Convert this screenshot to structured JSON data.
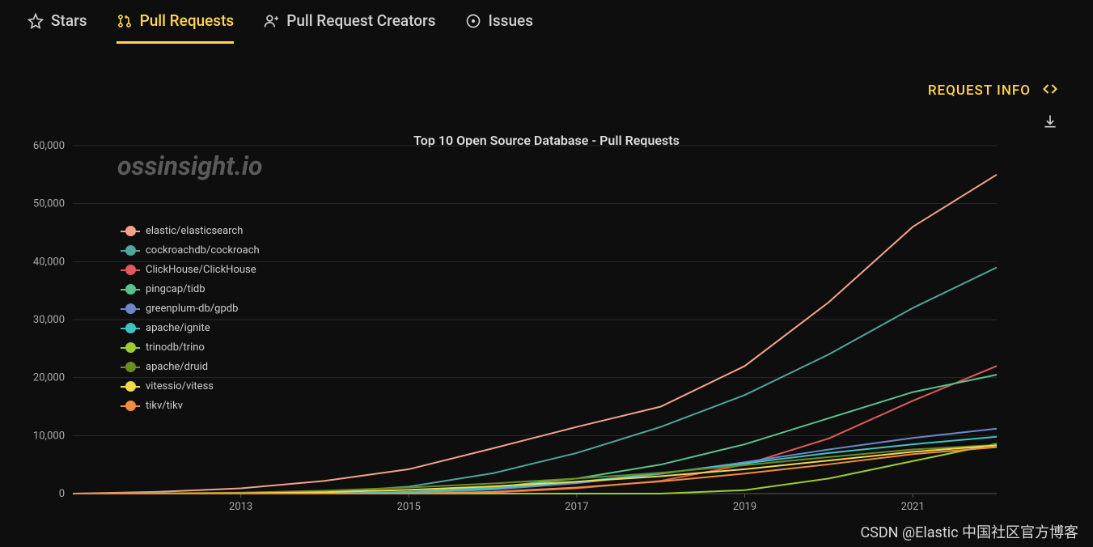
{
  "tabs": [
    {
      "label": "Stars",
      "active": false
    },
    {
      "label": "Pull Requests",
      "active": true
    },
    {
      "label": "Pull Request Creators",
      "active": false
    },
    {
      "label": "Issues",
      "active": false
    }
  ],
  "controls": {
    "request_info": "REQUEST INFO"
  },
  "watermark": "ossinsight.io",
  "csdn": "CSDN @Elastic 中国社区官方博客",
  "chart_data": {
    "type": "line",
    "title": "Top 10 Open Source Database - Pull Requests",
    "xlabel": "",
    "ylabel": "",
    "x": [
      2011,
      2012,
      2013,
      2014,
      2015,
      2016,
      2017,
      2018,
      2019,
      2020,
      2021,
      2022
    ],
    "x_ticks": [
      2013,
      2015,
      2017,
      2019,
      2021
    ],
    "ylim": [
      0,
      60000
    ],
    "y_ticks": [
      0,
      10000,
      20000,
      30000,
      40000,
      50000,
      60000
    ],
    "legend_position": "inside-top-left",
    "series": [
      {
        "name": "elastic/elasticsearch",
        "color": "#f4a28c",
        "values": [
          0,
          300,
          900,
          2200,
          4200,
          7800,
          11500,
          15000,
          22000,
          33000,
          46000,
          55000
        ]
      },
      {
        "name": "cockroachdb/cockroach",
        "color": "#4fa69a",
        "values": [
          0,
          0,
          0,
          200,
          1200,
          3500,
          7000,
          11500,
          17000,
          24000,
          32000,
          39000
        ]
      },
      {
        "name": "ClickHouse/ClickHouse",
        "color": "#e05a5a",
        "values": [
          0,
          0,
          0,
          0,
          0,
          200,
          900,
          2200,
          5000,
          9500,
          16000,
          22000
        ]
      },
      {
        "name": "pingcap/tidb",
        "color": "#5ac18e",
        "values": [
          0,
          0,
          0,
          0,
          300,
          1100,
          2600,
          5000,
          8500,
          13000,
          17500,
          20500
        ]
      },
      {
        "name": "greenplum-db/gpdb",
        "color": "#6d86c5",
        "values": [
          0,
          0,
          0,
          0,
          150,
          700,
          1800,
          3400,
          5400,
          7600,
          9600,
          11200
        ]
      },
      {
        "name": "apache/ignite",
        "color": "#3fc4c4",
        "values": [
          0,
          0,
          0,
          0,
          200,
          900,
          2000,
          3500,
          5200,
          7000,
          8500,
          9800
        ]
      },
      {
        "name": "trinodb/trino",
        "color": "#9acd32",
        "values": [
          0,
          0,
          0,
          0,
          0,
          0,
          0,
          0,
          600,
          2600,
          5600,
          8600
        ]
      },
      {
        "name": "apache/druid",
        "color": "#6b8e23",
        "values": [
          0,
          50,
          180,
          500,
          1050,
          1750,
          2600,
          3600,
          4900,
          6300,
          7600,
          8400
        ]
      },
      {
        "name": "vitessio/vitess",
        "color": "#f2d94e",
        "values": [
          0,
          0,
          50,
          250,
          650,
          1250,
          2050,
          3000,
          4200,
          5700,
          7200,
          8300
        ]
      },
      {
        "name": "tikv/tikv",
        "color": "#f28c3f",
        "values": [
          0,
          0,
          0,
          0,
          0,
          300,
          1050,
          2100,
          3450,
          5050,
          6800,
          8000
        ]
      }
    ]
  }
}
